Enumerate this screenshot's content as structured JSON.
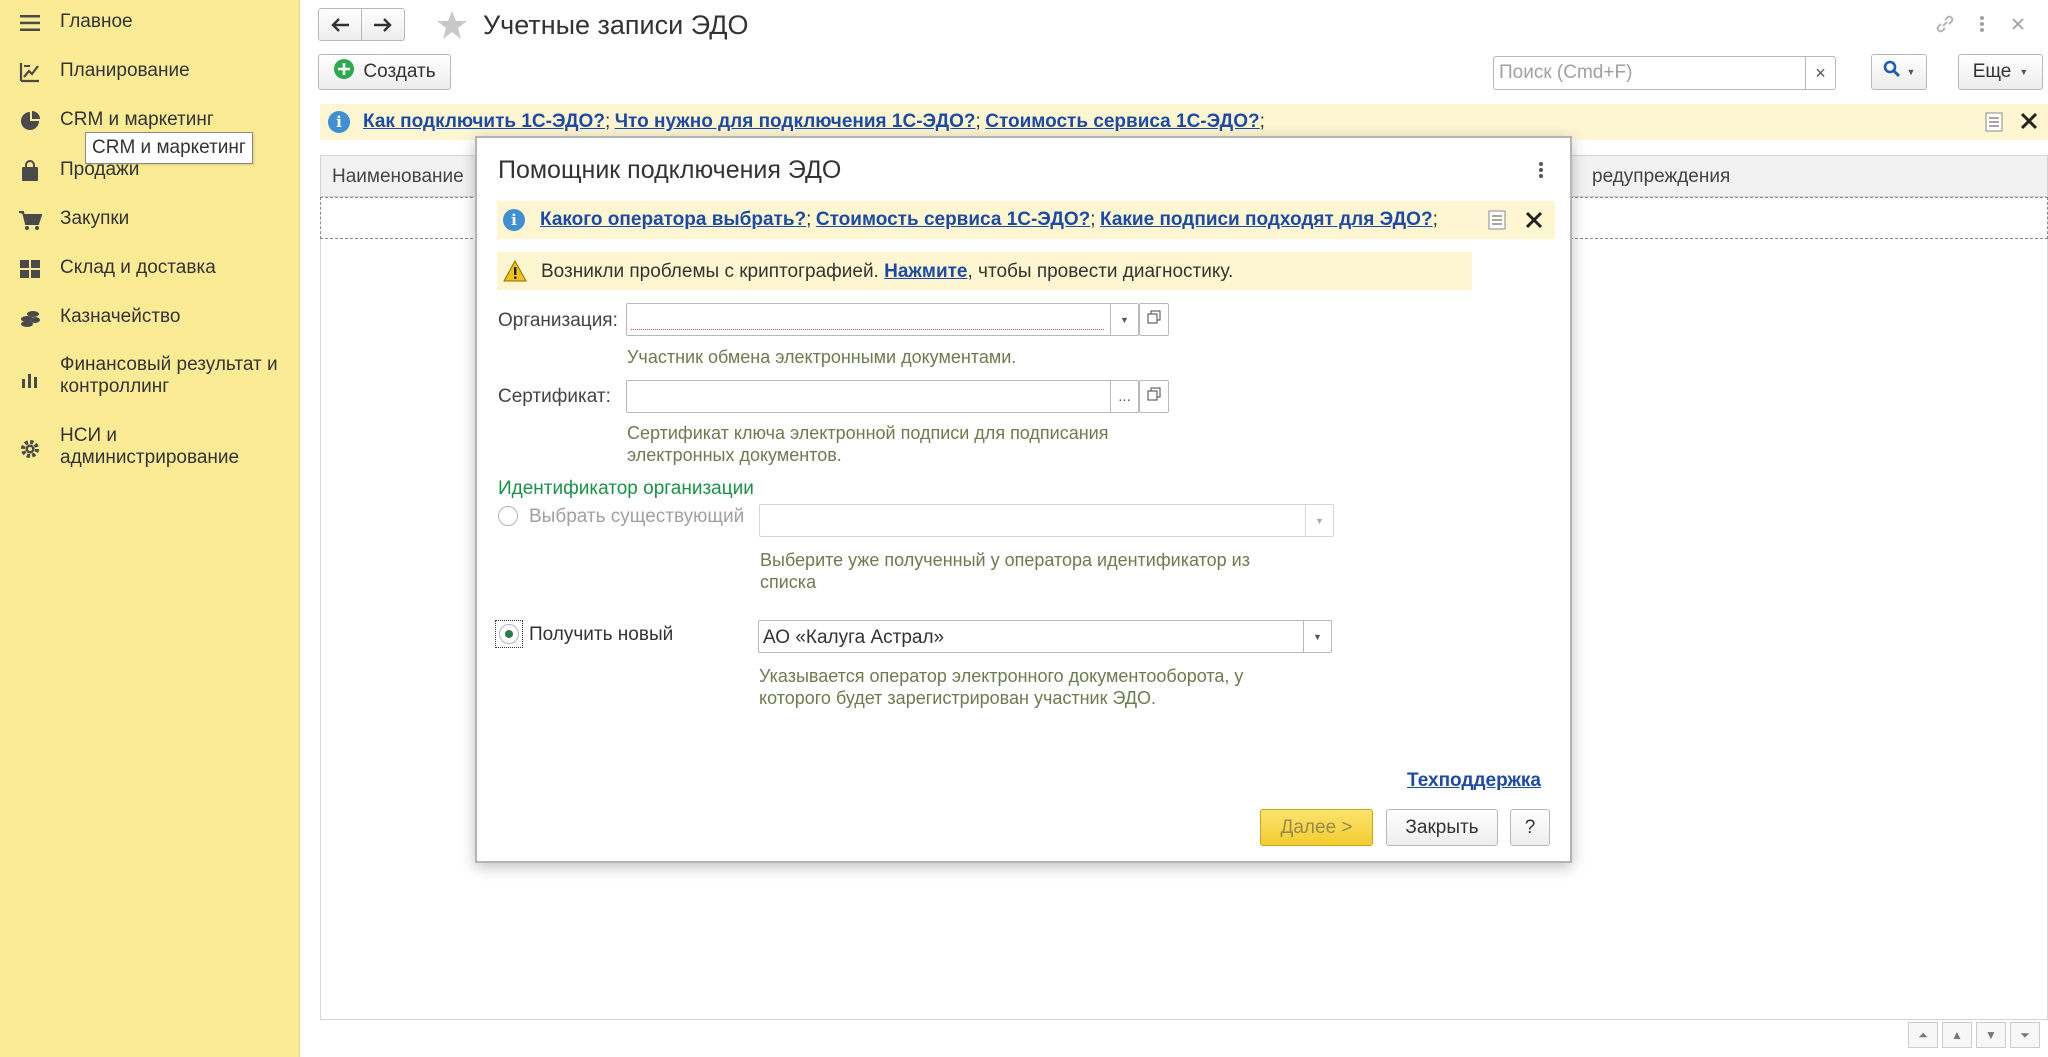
{
  "sidebar": {
    "items": [
      {
        "label": "Главное",
        "icon": "menu-icon"
      },
      {
        "label": "Планирование",
        "icon": "planning-icon"
      },
      {
        "label": "CRM и маркетинг",
        "icon": "pie-chart-icon"
      },
      {
        "label": "Продажи",
        "icon": "shopping-bag-icon"
      },
      {
        "label": "Закупки",
        "icon": "cart-icon"
      },
      {
        "label": "Склад и доставка",
        "icon": "warehouse-icon"
      },
      {
        "label": "Казначейство",
        "icon": "coins-icon"
      },
      {
        "label": "Финансовый результат и контроллинг",
        "icon": "bar-chart-icon"
      },
      {
        "label": "НСИ и администрирование",
        "icon": "gear-icon"
      }
    ],
    "tooltip": "CRM и маркетинг"
  },
  "header": {
    "title": "Учетные записи ЭДО",
    "create_label": "Создать",
    "search_placeholder": "Поиск (Cmd+F)",
    "search_clear": "×",
    "more_label": "Еще"
  },
  "info_bar": {
    "links": [
      "Как подключить 1С-ЭДО?",
      "Что нужно для подключения 1С-ЭДО?",
      "Стоимость сервиса 1С-ЭДО?"
    ],
    "separator": ";"
  },
  "table": {
    "columns": [
      "Наименование",
      "редупреждения"
    ]
  },
  "dialog": {
    "title": "Помощник подключения ЭДО",
    "info_links": [
      "Какого оператора выбрать?",
      "Стоимость сервиса 1С-ЭДО?",
      "Какие подписи подходят для ЭДО?"
    ],
    "warning": {
      "prefix": "Возникли проблемы с криптографией. ",
      "link": "Нажмите",
      "suffix": ", чтобы провести диагностику."
    },
    "organization": {
      "label": "Организация:",
      "value": "",
      "hint": "Участник обмена электронными документами."
    },
    "certificate": {
      "label": "Сертификат:",
      "value": "",
      "select_button": "...",
      "hint_line1": "Сертификат ключа электронной подписи для подписания",
      "hint_line2": "электронных документов."
    },
    "org_id_section": "Идентификатор организации",
    "choose_existing": {
      "label": "Выбрать существующий",
      "selected": false,
      "hint_line1": "Выберите уже полученный у оператора идентификатор из",
      "hint_line2": "списка"
    },
    "get_new": {
      "label": "Получить новый",
      "selected": true,
      "value": "АО «Калуга Астрал»",
      "hint_line1": "Указывается оператор электронного документооборота, у",
      "hint_line2": "которого будет зарегистрирован участник ЭДО."
    },
    "tech_support": "Техподдержка",
    "next_label": "Далее >",
    "close_label": "Закрыть",
    "help_label": "?"
  },
  "colors": {
    "sidebar_bg": "#fbeb95",
    "info_bg": "#fdf6d0",
    "link": "#1c4aa6",
    "hint": "#6e7a50",
    "section": "#1a9246",
    "accent_yellow": "#f3cc31"
  }
}
